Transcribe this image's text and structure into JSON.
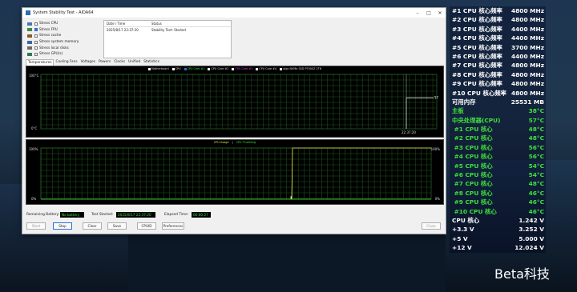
{
  "window": {
    "title": "System Stability Test - AIDA64"
  },
  "stress_options": [
    {
      "label": "Stress CPU",
      "checked": false,
      "color": "#4a78b0"
    },
    {
      "label": "Stress FPU",
      "checked": true,
      "color": "#3f8a4a"
    },
    {
      "label": "Stress cache",
      "checked": false,
      "color": "#8a5a2a"
    },
    {
      "label": "Stress system memory",
      "checked": false,
      "color": "#3a6a9a"
    },
    {
      "label": "Stress local disks",
      "checked": false,
      "color": "#6a6a6a"
    },
    {
      "label": "Stress GPU(s)",
      "checked": false,
      "color": "#2a7a5a"
    }
  ],
  "status_table": {
    "col_datetime": "Date / Time",
    "col_status": "Status",
    "rows": [
      {
        "datetime": "2025/8/17 22:37:20",
        "status": "Stability Test: Started"
      }
    ]
  },
  "tabs": [
    "Temperatures",
    "Cooling Fans",
    "Voltages",
    "Powers",
    "Clocks",
    "Unified",
    "Statistics"
  ],
  "temp_graph": {
    "legend": [
      {
        "label": "Motherboard",
        "checked": false,
        "color": "#ddd"
      },
      {
        "label": "CPU",
        "checked": false,
        "color": "#ddd"
      },
      {
        "label": "CPU Core #1",
        "checked": true,
        "color": "#3ee03e"
      },
      {
        "label": "CPU Core #2",
        "checked": false,
        "color": "#ddd"
      },
      {
        "label": "CPU Core #3",
        "checked": false,
        "color": "#e040e0"
      },
      {
        "label": "CPU Core #4",
        "checked": false,
        "color": "#ddd"
      },
      {
        "label": "aigo NVMe SSD P7000Z 2TB",
        "checked": false,
        "color": "#ddd"
      }
    ],
    "y_max": "100°C",
    "y_min": "0°C",
    "time_label": "22:37:20",
    "value_label": "57",
    "chart_data": {
      "type": "line",
      "series": [
        {
          "name": "CPU Core #1",
          "values": [
            57,
            57
          ]
        }
      ],
      "ylim": [
        0,
        100
      ]
    }
  },
  "usage_graph": {
    "legend_a": "CPU Usage",
    "legend_sep": "|",
    "legend_b": "CPU Throttling",
    "y_max": "100%",
    "y_min": "0%",
    "right_max": "100%",
    "right_min": "0%",
    "chart_data": {
      "type": "line",
      "series": [
        {
          "name": "CPU Usage",
          "values": [
            0,
            100
          ]
        },
        {
          "name": "CPU Throttling",
          "values": [
            0,
            0
          ]
        }
      ],
      "ylim": [
        0,
        100
      ]
    }
  },
  "bottom": {
    "battery_label": "Remaining Battery:",
    "battery_value": "No battery",
    "started_label": "Test Started:",
    "started_value": "2025/8/17 22:37:20",
    "elapsed_label": "Elapsed Time:",
    "elapsed_value": "00:00:27",
    "buttons": {
      "start": "Start",
      "stop": "Stop",
      "clear": "Clear",
      "save": "Save",
      "cpuid": "CPUID",
      "preferences": "Preferences",
      "close": "Close"
    }
  },
  "osd": [
    {
      "label": "#1 CPU 核心频率",
      "value": "4800 MHz",
      "color": "#ffffff"
    },
    {
      "label": "#2 CPU 核心频率",
      "value": "4800 MHz",
      "color": "#ffffff"
    },
    {
      "label": "#3 CPU 核心频率",
      "value": "4400 MHz",
      "color": "#ffffff"
    },
    {
      "label": "#4 CPU 核心频率",
      "value": "4400 MHz",
      "color": "#ffffff"
    },
    {
      "label": "#5 CPU 核心频率",
      "value": "3700 MHz",
      "color": "#ffffff"
    },
    {
      "label": "#6 CPU 核心频率",
      "value": "4400 MHz",
      "color": "#ffffff"
    },
    {
      "label": "#7 CPU 核心频率",
      "value": "4800 MHz",
      "color": "#ffffff"
    },
    {
      "label": "#8 CPU 核心频率",
      "value": "4800 MHz",
      "color": "#ffffff"
    },
    {
      "label": "#9 CPU 核心频率",
      "value": "4800 MHz",
      "color": "#ffffff"
    },
    {
      "label": "#10 CPU 核心频率",
      "value": "4800 MHz",
      "color": "#ffffff"
    },
    {
      "label": "可用内存",
      "value": "25531 MB",
      "color": "#ffffff"
    },
    {
      "label": "主板",
      "value": "38°C",
      "color": "#3ee03e"
    },
    {
      "label": "中央处理器(CPU)",
      "value": "57°C",
      "color": "#3ee03e"
    },
    {
      "label": " #1 CPU 核心",
      "value": "48°C",
      "color": "#3ee03e"
    },
    {
      "label": " #2 CPU 核心",
      "value": "48°C",
      "color": "#3ee03e"
    },
    {
      "label": " #3 CPU 核心",
      "value": "56°C",
      "color": "#3ee03e"
    },
    {
      "label": " #4 CPU 核心",
      "value": "56°C",
      "color": "#3ee03e"
    },
    {
      "label": " #5 CPU 核心",
      "value": "54°C",
      "color": "#3ee03e"
    },
    {
      "label": " #6 CPU 核心",
      "value": "54°C",
      "color": "#3ee03e"
    },
    {
      "label": " #7 CPU 核心",
      "value": "48°C",
      "color": "#3ee03e"
    },
    {
      "label": " #8 CPU 核心",
      "value": "46°C",
      "color": "#3ee03e"
    },
    {
      "label": " #9 CPU 核心",
      "value": "46°C",
      "color": "#3ee03e"
    },
    {
      "label": " #10 CPU 核心",
      "value": "46°C",
      "color": "#3ee03e"
    },
    {
      "label": "CPU 核心",
      "value": "1.242 V",
      "color": "#ffffff"
    },
    {
      "label": "+3.3 V",
      "value": "3.252 V",
      "color": "#ffffff"
    },
    {
      "label": "+5 V",
      "value": "5.000 V",
      "color": "#ffffff"
    },
    {
      "label": "+12 V",
      "value": "12.024 V",
      "color": "#ffffff"
    }
  ],
  "watermark": "Beta科技"
}
